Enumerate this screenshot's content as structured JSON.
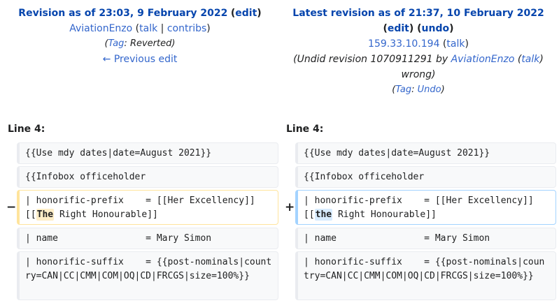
{
  "left": {
    "title": "Revision as of 23:03, 9 February 2022",
    "edit": "edit",
    "user": "AviationEnzo",
    "talk": "talk",
    "contribs": "contribs",
    "tag_label": "Tag",
    "tag_value": "Reverted",
    "prev_edit": "← Previous edit"
  },
  "right": {
    "title": "Latest revision as of 21:37, 10 February 2022",
    "edit": "edit",
    "undo": "undo",
    "ip": "159.33.10.194",
    "talk": "talk",
    "summary_prefix": "(Undid revision 1070911291 by ",
    "summary_user": "AviationEnzo",
    "summary_talk": "talk",
    "summary_suffix": "wrong)",
    "tag_label": "Tag",
    "tag_value": "Undo"
  },
  "diff": {
    "left_line_label": "Line 4:",
    "right_line_label": "Line 4:",
    "minus": "−",
    "plus": "+",
    "ctx1": "{{Use mdy dates|date=August 2021}}",
    "ctx2": "{{Infobox officeholder",
    "changed_prefix": "| honorific-prefix    = [[Her Excellency]] [[",
    "old_word": "The",
    "new_word": "the",
    "changed_suffix": " Right Honourable]]",
    "ctx3": "| name                = Mary Simon",
    "ctx4": "| honorific-suffix    = {{post-nominals|country=CAN|CC|CMM|COM|OQ|CD|FRCGS|size=100%}}"
  }
}
